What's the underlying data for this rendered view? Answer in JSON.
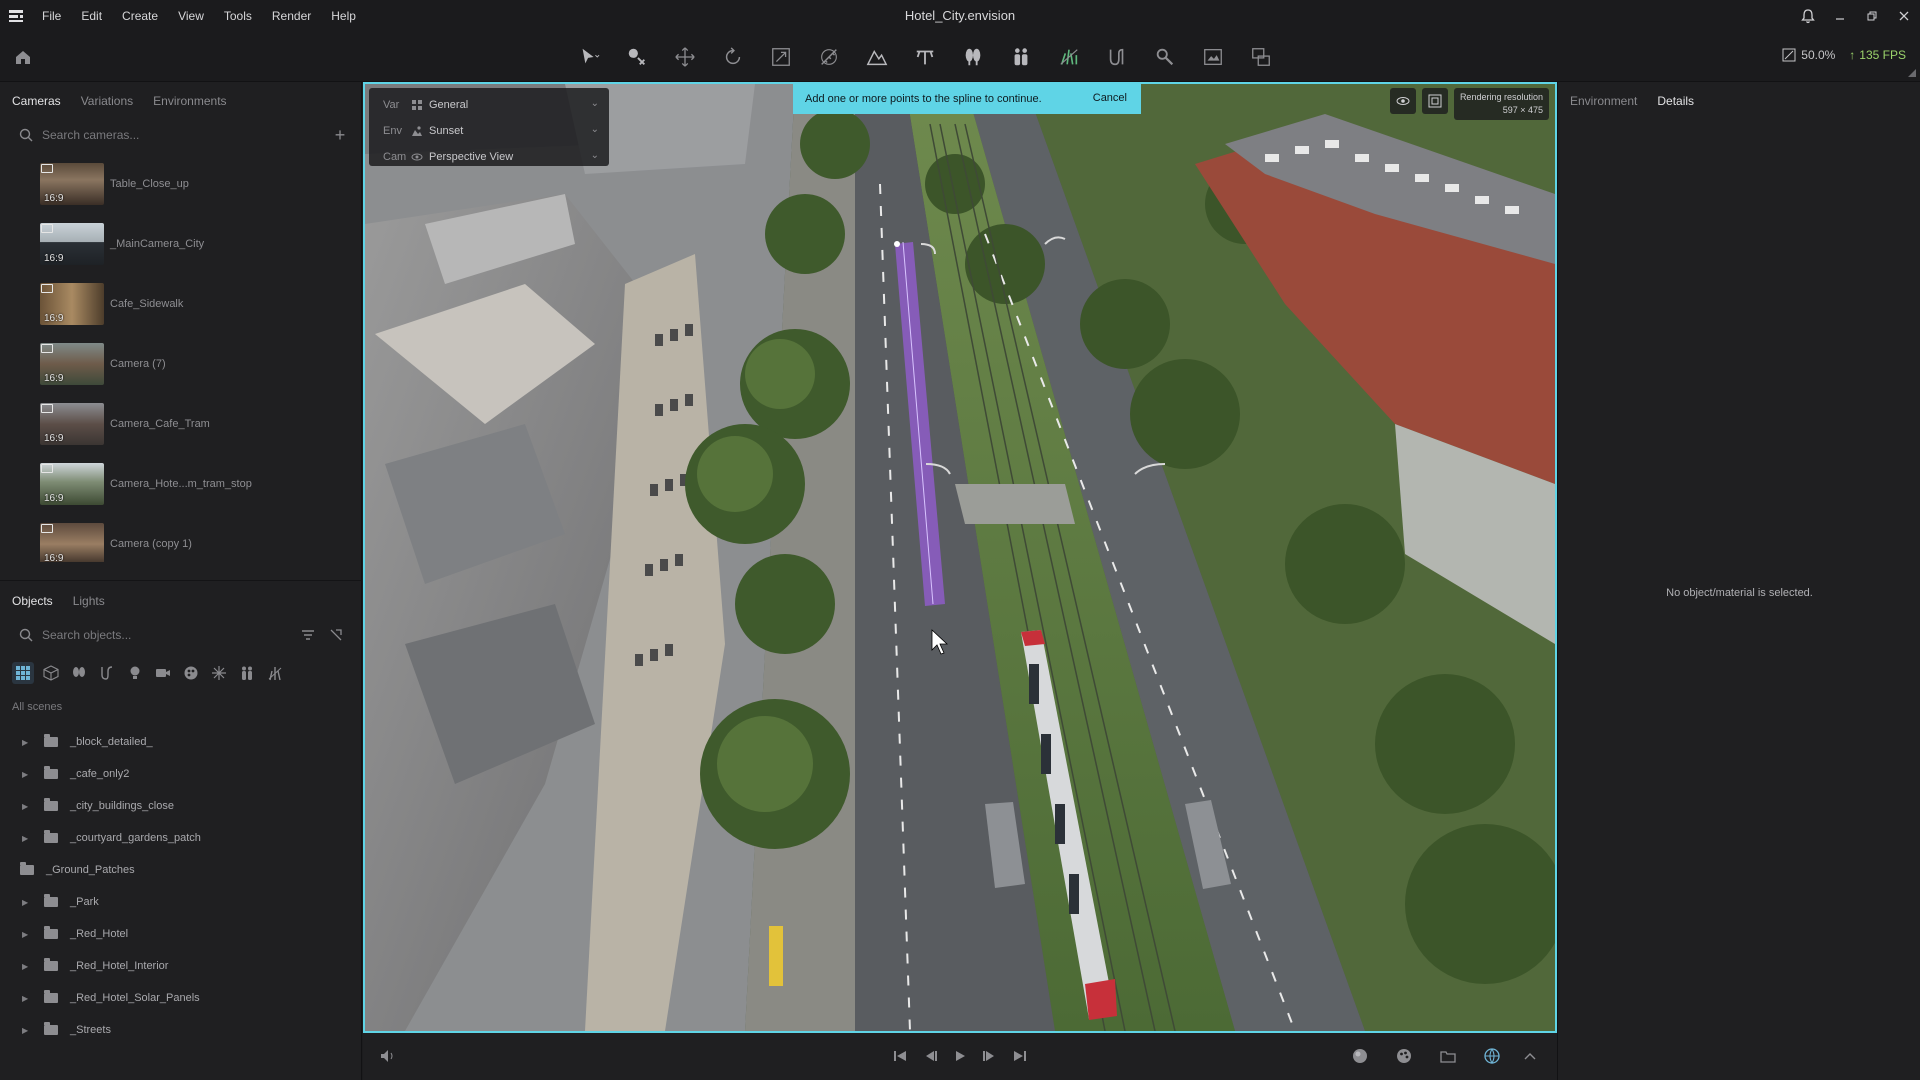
{
  "window": {
    "title": "Hotel_City.envision"
  },
  "menu": [
    "File",
    "Edit",
    "Create",
    "View",
    "Tools",
    "Render",
    "Help"
  ],
  "toolbar": {
    "tools": [
      "select-tool-icon",
      "paint-tool-icon",
      "move-tool-icon",
      "rotate-tool-icon",
      "scale-tool-icon",
      "measure-tool-icon",
      "terrain-tool-icon",
      "road-tool-icon",
      "tree-tool-icon",
      "people-tool-icon",
      "grass-tool-icon",
      "spline-tool-icon",
      "magnet-tool-icon",
      "screenshot-tool-icon",
      "compare-tool-icon"
    ],
    "zoom": "50.0%",
    "fps": "135 FPS"
  },
  "left_panel": {
    "tabs": [
      "Cameras",
      "Variations",
      "Environments"
    ],
    "camera_search_placeholder": "Search cameras...",
    "cameras": [
      {
        "name": "Table_Close_up",
        "ratio": "16:9"
      },
      {
        "name": "_MainCamera_City",
        "ratio": "16:9"
      },
      {
        "name": "Cafe_Sidewalk",
        "ratio": "16:9"
      },
      {
        "name": "Camera (7)",
        "ratio": "16:9"
      },
      {
        "name": "Camera_Cafe_Tram",
        "ratio": "16:9"
      },
      {
        "name": "Camera_Hote...m_tram_stop",
        "ratio": "16:9"
      },
      {
        "name": "Camera (copy 1)",
        "ratio": "16:9"
      }
    ],
    "object_tabs": [
      "Objects",
      "Lights"
    ],
    "object_search_placeholder": "Search objects...",
    "all_scenes": "All scenes",
    "tree": [
      {
        "label": "_block_detailed_",
        "expandable": true
      },
      {
        "label": "_cafe_only2",
        "expandable": true
      },
      {
        "label": "_city_buildings_close",
        "expandable": true
      },
      {
        "label": "_courtyard_gardens_patch",
        "expandable": true
      },
      {
        "label": "_Ground_Patches",
        "expandable": false
      },
      {
        "label": "_Park",
        "expandable": true
      },
      {
        "label": "_Red_Hotel",
        "expandable": true
      },
      {
        "label": "_Red_Hotel_Interior",
        "expandable": true
      },
      {
        "label": "_Red_Hotel_Solar_Panels",
        "expandable": true
      },
      {
        "label": "_Streets",
        "expandable": true
      }
    ]
  },
  "viewport": {
    "overlay": [
      {
        "key": "Var",
        "value": "General"
      },
      {
        "key": "Env",
        "value": "Sunset"
      },
      {
        "key": "Cam",
        "value": "Perspective View"
      }
    ],
    "banner": {
      "message": "Add one or more points to the spline to continue.",
      "cancel": "Cancel"
    },
    "render_resolution_label": "Rendering resolution",
    "render_resolution_value": "597 × 475",
    "accent": "#5fd4e6"
  },
  "right_panel": {
    "tabs": [
      "Environment",
      "Details"
    ],
    "empty_message": "No object/material is selected."
  }
}
